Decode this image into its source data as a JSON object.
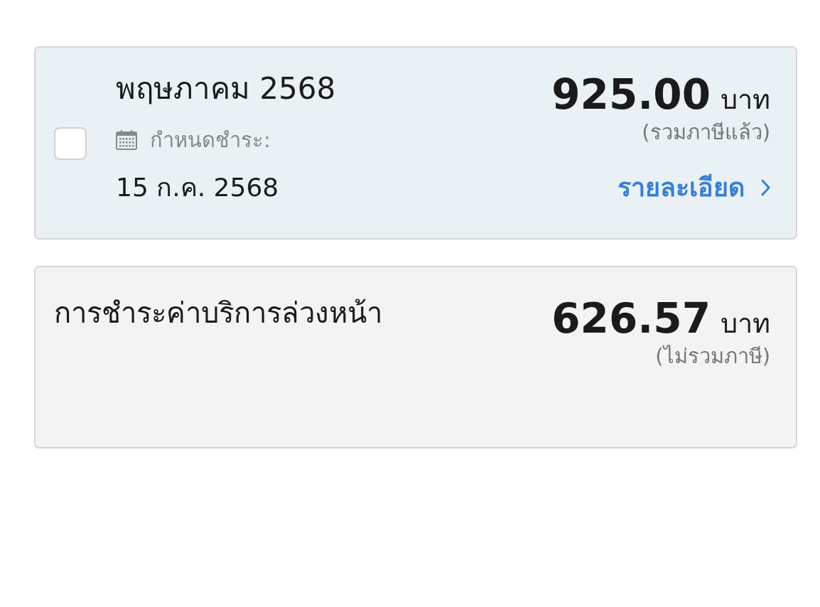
{
  "bill": {
    "month": "พฤษภาคม 2568",
    "checked": false,
    "due_label": "กำหนดชำระ:",
    "due_date": "15 ก.ค. 2568",
    "amount": "925.00",
    "currency": "บาท",
    "tax_note": "(รวมภาษีแล้ว)",
    "details_link": "รายละเอียด"
  },
  "advance_payment": {
    "title": "การชำระค่าบริการล่วงหน้า",
    "amount": "626.57",
    "currency": "บาท",
    "tax_note": "(ไม่รวมภาษี)"
  }
}
